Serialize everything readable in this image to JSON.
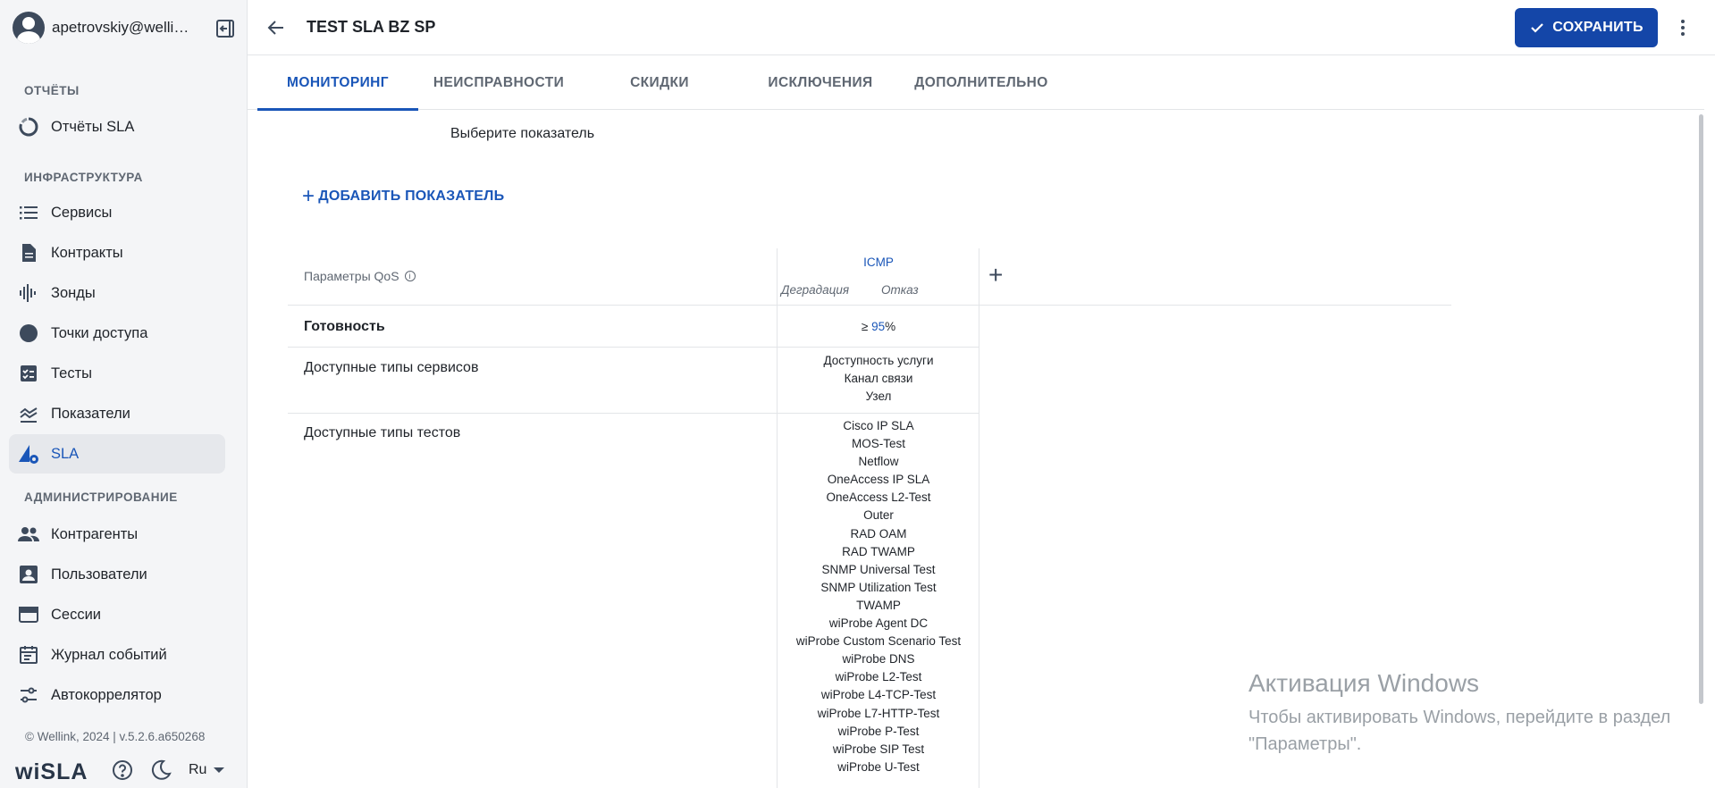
{
  "sidebar": {
    "user_email": "apetrovskiy@wellin...",
    "sections": {
      "reports": "ОТЧЁТЫ",
      "infrastructure": "ИНФРАСТРУКТУРА",
      "administration": "АДМИНИСТРИРОВАНИЕ"
    },
    "items": [
      {
        "label": "Отчёты SLA",
        "icon": "sla-report-icon"
      },
      {
        "label": "Сервисы",
        "icon": "list-icon"
      },
      {
        "label": "Контракты",
        "icon": "document-icon"
      },
      {
        "label": "Зонды",
        "icon": "probe-icon"
      },
      {
        "label": "Точки доступа",
        "icon": "access-point-icon"
      },
      {
        "label": "Тесты",
        "icon": "test-checklist-icon"
      },
      {
        "label": "Показатели",
        "icon": "metrics-icon"
      },
      {
        "label": "SLA",
        "icon": "sla-gear-icon",
        "active": true
      },
      {
        "label": "Контрагенты",
        "icon": "people-icon"
      },
      {
        "label": "Пользователи",
        "icon": "user-badge-icon"
      },
      {
        "label": "Сессии",
        "icon": "browser-window-icon"
      },
      {
        "label": "Журнал событий",
        "icon": "calendar-icon"
      },
      {
        "label": "Автокоррелятор",
        "icon": "sliders-icon"
      }
    ],
    "footer": {
      "copyright": "© Wellink, 2024 | v.5.2.6.a650268",
      "brand": "wiSLA",
      "language": "Ru"
    }
  },
  "header": {
    "title": "TEST SLA BZ SP",
    "save_label": "СОХРАНИТЬ"
  },
  "tabs": [
    {
      "label": "МОНИТОРИНГ",
      "active": true
    },
    {
      "label": "НЕИСПРАВНОСТИ"
    },
    {
      "label": "СКИДКИ"
    },
    {
      "label": "ИСКЛЮЧЕНИЯ"
    },
    {
      "label": "ДОПОЛНИТЕЛЬНО"
    }
  ],
  "content": {
    "choose_metric": "Выберите показатель",
    "add_metric": "ДОБАВИТЬ ПОКАЗАТЕЛЬ",
    "table": {
      "qos_header": "Параметры QoS",
      "column_name": "ICMP",
      "degradation": "Деградация",
      "failure": "Отказ",
      "readiness_label": "Готовность",
      "readiness_op": "≥",
      "readiness_value": "95",
      "readiness_unit": "%",
      "service_types_label": "Доступные типы сервисов",
      "service_types": [
        "Доступность услуги",
        "Канал связи",
        "Узел"
      ],
      "test_types_label": "Доступные типы тестов",
      "test_types": [
        "Cisco IP SLA",
        "MOS-Test",
        "Netflow",
        "OneAccess IP SLA",
        "OneAccess L2-Test",
        "Outer",
        "RAD OAM",
        "RAD TWAMP",
        "SNMP Universal Test",
        "SNMP Utilization Test",
        "TWAMP",
        "wiProbe Agent DC",
        "wiProbe Custom Scenario Test",
        "wiProbe DNS",
        "wiProbe L2-Test",
        "wiProbe L4-TCP-Test",
        "wiProbe L7-HTTP-Test",
        "wiProbe P-Test",
        "wiProbe SIP Test",
        "wiProbe U-Test"
      ]
    }
  },
  "watermark": {
    "title": "Активация Windows",
    "subtitle": "Чтобы активировать Windows, перейдите в раздел \"Параметры\"."
  },
  "colors": {
    "accent": "#1a56b8",
    "save_button": "#1446a8",
    "sidebar_bg": "#f4f5f7"
  }
}
